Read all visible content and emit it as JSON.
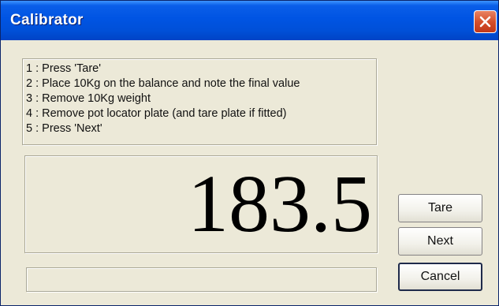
{
  "window": {
    "title": "Calibrator",
    "close_icon": "close-icon"
  },
  "instructions": [
    "1 : Press 'Tare'",
    "2 : Place 10Kg on the balance and note the final value",
    "3 : Remove 10Kg weight",
    "4 : Remove pot locator plate (and tare plate if fitted)",
    "5 : Press 'Next'"
  ],
  "readout": {
    "value": "183.5"
  },
  "status": {
    "text": ""
  },
  "buttons": {
    "tare": "Tare",
    "next": "Next",
    "cancel": "Cancel"
  },
  "colors": {
    "titlebar": "#0054e3",
    "close_button": "#d5502c",
    "dialog_background": "#ece9d8"
  }
}
